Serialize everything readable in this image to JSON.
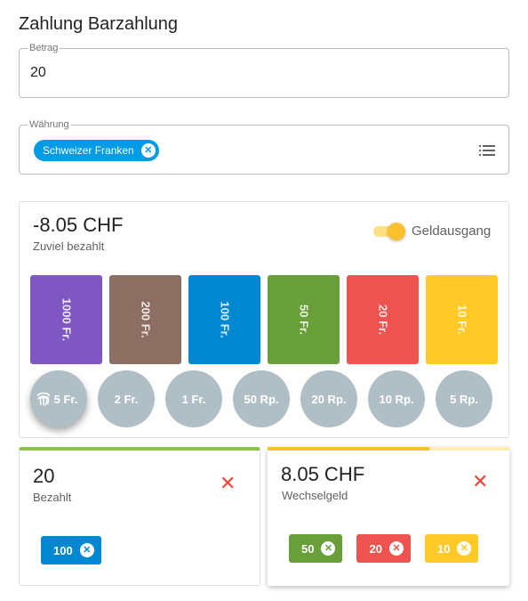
{
  "title": "Zahlung Barzahlung",
  "amount_field": {
    "label": "Betrag",
    "value": "20"
  },
  "currency_field": {
    "label": "Währung",
    "chip": "Schweizer Franken",
    "chip_remove": "✕"
  },
  "summary": {
    "amount": "-8.05 CHF",
    "status": "Zuviel bezahlt",
    "toggle_label": "Geldausgang",
    "toggle_on": true
  },
  "notes": [
    {
      "label": "1000 Fr.",
      "color": "#7e57c2"
    },
    {
      "label": "200 Fr.",
      "color": "#8d6e63"
    },
    {
      "label": "100 Fr.",
      "color": "#0288d1"
    },
    {
      "label": "50 Fr.",
      "color": "#689f38"
    },
    {
      "label": "20 Fr.",
      "color": "#ef5350"
    },
    {
      "label": "10 Fr.",
      "color": "#ffca28"
    }
  ],
  "coins": [
    {
      "label": "5 Fr.",
      "active": true
    },
    {
      "label": "2 Fr."
    },
    {
      "label": "1 Fr."
    },
    {
      "label": "50 Rp."
    },
    {
      "label": "20 Rp."
    },
    {
      "label": "10 Rp."
    },
    {
      "label": "5 Rp."
    }
  ],
  "paid": {
    "amount": "20",
    "label": "Bezahlt",
    "close": "✕",
    "tokens": [
      {
        "label": "100",
        "color": "#0288d1",
        "remove": "✕"
      }
    ]
  },
  "change": {
    "amount": "8.05 CHF",
    "label": "Wechselgeld",
    "close": "✕",
    "progress": 0.67,
    "accent": "#fbc02d",
    "tokens": [
      {
        "label": "50",
        "color": "#689f38",
        "remove": "✕"
      },
      {
        "label": "20",
        "color": "#ef5350",
        "remove": "✕"
      },
      {
        "label": "10",
        "color": "#ffca28",
        "remove": "✕"
      }
    ]
  }
}
